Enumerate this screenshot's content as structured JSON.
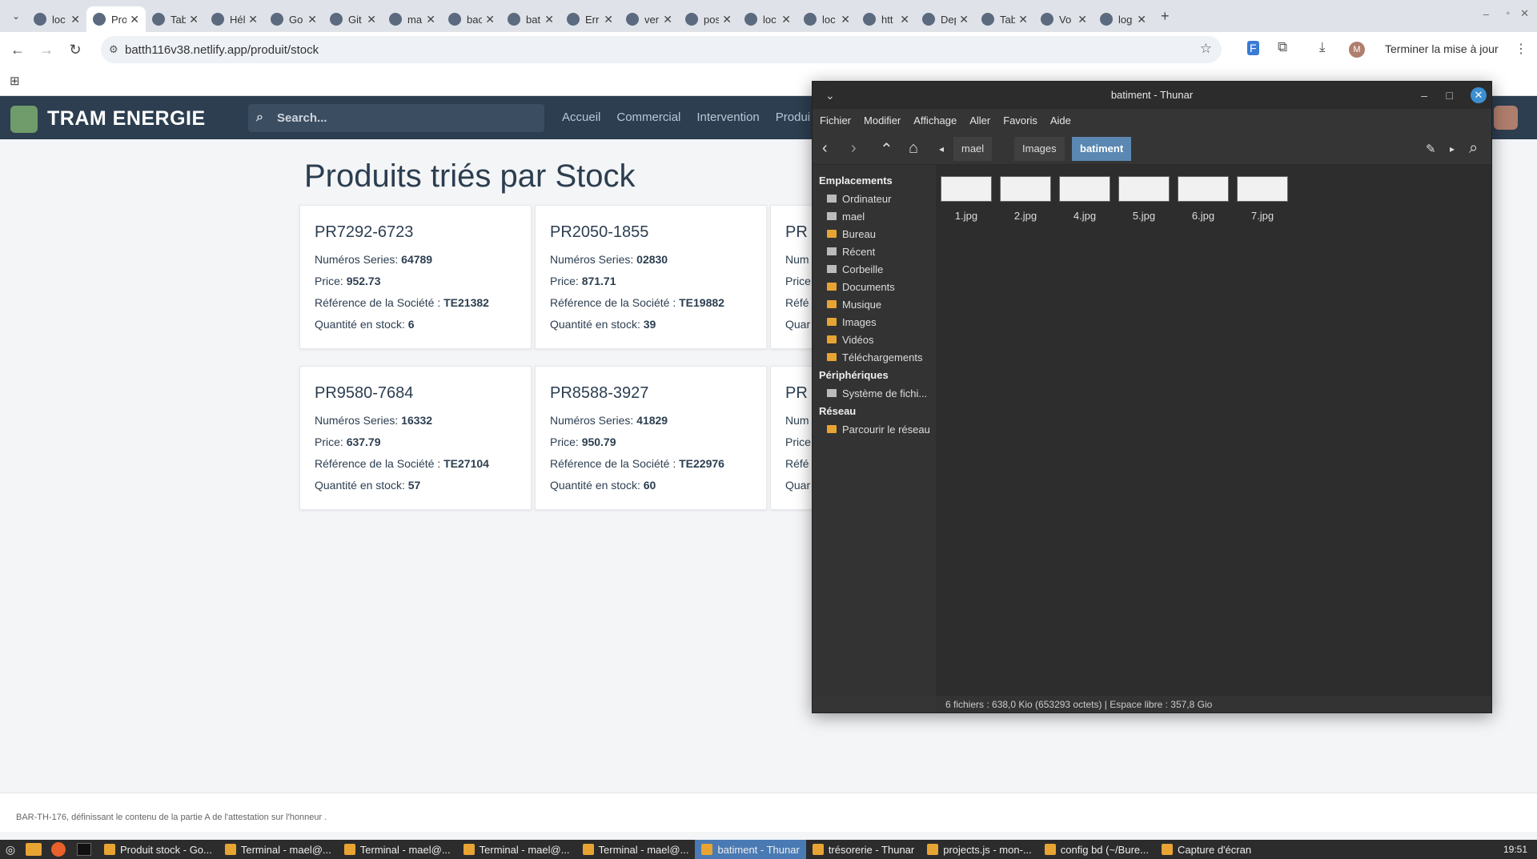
{
  "browser": {
    "tabs": [
      {
        "label": "loc"
      },
      {
        "label": "Pro",
        "active": true
      },
      {
        "label": "Tab"
      },
      {
        "label": "Hél"
      },
      {
        "label": "Go"
      },
      {
        "label": "Git"
      },
      {
        "label": "ma"
      },
      {
        "label": "bac"
      },
      {
        "label": "bat"
      },
      {
        "label": "Err"
      },
      {
        "label": "ver"
      },
      {
        "label": "pos"
      },
      {
        "label": "loc"
      },
      {
        "label": "loc"
      },
      {
        "label": "htt"
      },
      {
        "label": "Dep"
      },
      {
        "label": "Tab"
      },
      {
        "label": "Vo"
      },
      {
        "label": "log"
      }
    ],
    "url": "batth116v38.netlify.app/produit/stock",
    "update_label": "Terminer la mise à jour",
    "profile_initial": "M"
  },
  "app": {
    "brand": "TRAM ENERGIE",
    "search_placeholder": "Search...",
    "menu": [
      "Accueil",
      "Commercial",
      "Intervention",
      "Produi"
    ]
  },
  "page": {
    "title": "Produits triés par Stock",
    "labels": {
      "series": "Numéros Series: ",
      "price": "Price: ",
      "ref": "Référence de la Société : ",
      "qty": "Quantité en stock: "
    },
    "cards": [
      {
        "code": "PR7292-6723",
        "series": "64789",
        "price": "952.73",
        "ref": "TE21382",
        "qty": "6"
      },
      {
        "code": "PR2050-1855",
        "series": "02830",
        "price": "871.71",
        "ref": "TE19882",
        "qty": "39"
      },
      {
        "code": "PR",
        "series": "",
        "price": "",
        "ref": "",
        "qty": ""
      },
      {
        "code": "PR9580-7684",
        "series": "16332",
        "price": "637.79",
        "ref": "TE27104",
        "qty": "57"
      },
      {
        "code": "PR8588-3927",
        "series": "41829",
        "price": "950.79",
        "ref": "TE22976",
        "qty": "60"
      },
      {
        "code": "PR",
        "series": "",
        "price": "",
        "ref": "",
        "qty": ""
      }
    ],
    "partial_labels": {
      "series": "Num",
      "price": "Price",
      "ref": "Réfé",
      "qty": "Quar"
    },
    "footer": "BAR-TH-176, définissant le contenu de la partie A de l'attestation sur l'honneur ."
  },
  "thunar": {
    "title": "batiment - Thunar",
    "menu": [
      "Fichier",
      "Modifier",
      "Affichage",
      "Aller",
      "Favoris",
      "Aide"
    ],
    "path": [
      "mael",
      "Images",
      "batiment"
    ],
    "sections": {
      "places": "Emplacements",
      "devices": "Périphériques",
      "network": "Réseau"
    },
    "places": [
      "Ordinateur",
      "mael",
      "Bureau",
      "Récent",
      "Corbeille",
      "Documents",
      "Musique",
      "Images",
      "Vidéos",
      "Téléchargements"
    ],
    "devices": [
      "Système de fichi..."
    ],
    "network": [
      "Parcourir le réseau"
    ],
    "files": [
      "1.jpg",
      "2.jpg",
      "4.jpg",
      "5.jpg",
      "6.jpg",
      "7.jpg"
    ],
    "status": "6 fichiers : 638,0 Kio (653293 octets)  |  Espace libre : 357,8 Gio"
  },
  "taskbar": {
    "items": [
      {
        "label": "Produit stock - Go..."
      },
      {
        "label": "Terminal - mael@..."
      },
      {
        "label": "Terminal - mael@..."
      },
      {
        "label": "Terminal - mael@..."
      },
      {
        "label": "Terminal - mael@..."
      },
      {
        "label": "batiment - Thunar",
        "active": true
      },
      {
        "label": "trésorerie - Thunar"
      },
      {
        "label": "projects.js - mon-..."
      },
      {
        "label": "config bd (~/Bure..."
      },
      {
        "label": "Capture d'écran"
      }
    ],
    "time": "19:51"
  }
}
